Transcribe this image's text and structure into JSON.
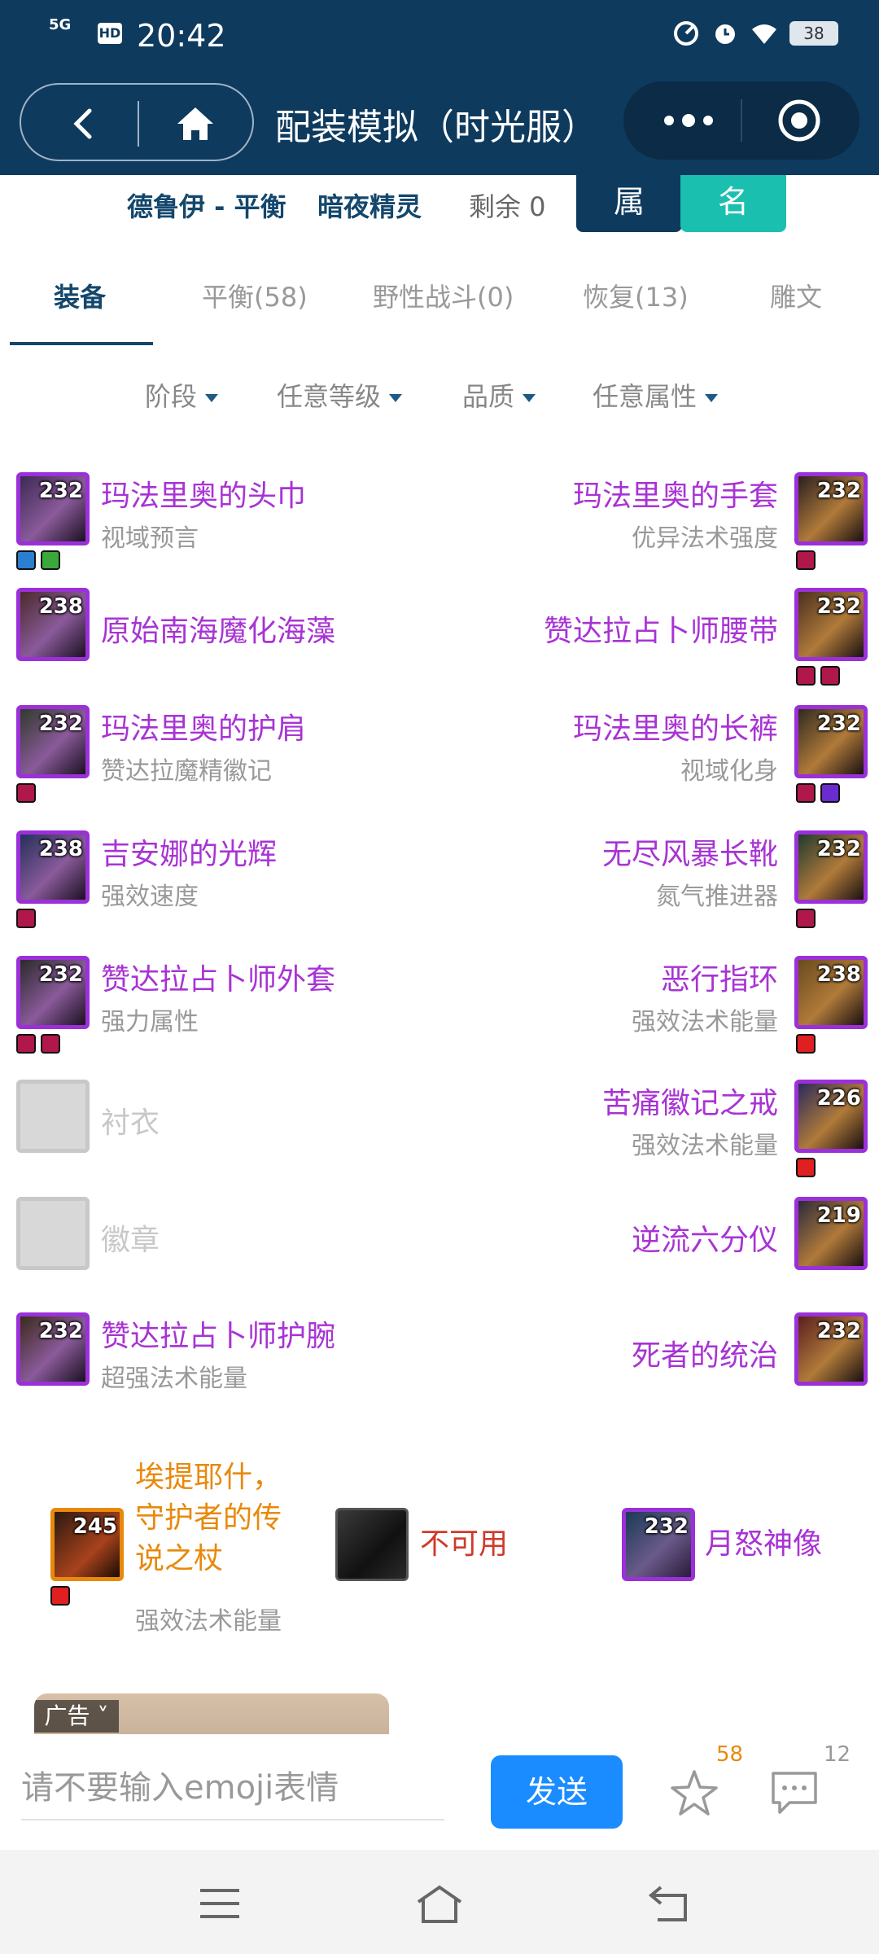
{
  "status_bar": {
    "signal": "5G",
    "hd": "HD",
    "time": "20:42",
    "battery": "38"
  },
  "header": {
    "title": "配装模拟（时光服）"
  },
  "character": {
    "class_spec": "德鲁伊 - 平衡",
    "race": "暗夜精灵",
    "remaining": "剩余 0",
    "attr_button": "属",
    "name_button": "名"
  },
  "tabs": [
    "装备",
    "平衡(58)",
    "野性战斗(0)",
    "恢复(13)",
    "雕文"
  ],
  "filters": [
    "阶段",
    "任意等级",
    "品质",
    "任意属性"
  ],
  "left_items": [
    {
      "level": "232",
      "name": "玛法里奥的头巾",
      "sub": "视域预言",
      "gems": [
        "#2a7fd1",
        "#3aa83a"
      ]
    },
    {
      "level": "238",
      "name": "原始南海魔化海藻",
      "sub": "",
      "gems": []
    },
    {
      "level": "232",
      "name": "玛法里奥的护肩",
      "sub": "赞达拉魔精徽记",
      "gems": [
        "#b0174a"
      ]
    },
    {
      "level": "238",
      "name": "吉安娜的光辉",
      "sub": "强效速度",
      "gems": [
        "#b0174a"
      ]
    },
    {
      "level": "232",
      "name": "赞达拉占卜师外套",
      "sub": "强力属性",
      "gems": [
        "#b0174a",
        "#b0174a"
      ]
    },
    {
      "level": "",
      "name": "衬衣",
      "sub": "",
      "gems": [],
      "empty": true
    },
    {
      "level": "",
      "name": "徽章",
      "sub": "",
      "gems": [],
      "empty": true
    },
    {
      "level": "232",
      "name": "赞达拉占卜师护腕",
      "sub": "超强法术能量",
      "gems": []
    }
  ],
  "right_items": [
    {
      "level": "232",
      "name": "玛法里奥的手套",
      "sub": "优异法术强度",
      "gems": [
        "#b0174a"
      ]
    },
    {
      "level": "232",
      "name": "赞达拉占卜师腰带",
      "sub": "",
      "gems": [
        "#b0174a",
        "#b0174a"
      ]
    },
    {
      "level": "232",
      "name": "玛法里奥的长裤",
      "sub": "视域化身",
      "gems": [
        "#b0174a",
        "#6a2bd1"
      ]
    },
    {
      "level": "232",
      "name": "无尽风暴长靴",
      "sub": "氮气推进器",
      "gems": [
        "#b0174a"
      ]
    },
    {
      "level": "238",
      "name": "恶行指环",
      "sub": "强效法术能量",
      "gems": [
        "#e02020"
      ]
    },
    {
      "level": "226",
      "name": "苦痛徽记之戒",
      "sub": "强效法术能量",
      "gems": [
        "#e02020"
      ]
    },
    {
      "level": "219",
      "name": "逆流六分仪",
      "sub": "",
      "gems": []
    },
    {
      "level": "232",
      "name": "死者的统治",
      "sub": "",
      "gems": []
    }
  ],
  "weapons": {
    "main": {
      "level": "245",
      "name_lines": [
        "埃提耶什，",
        "守护者的传",
        "说之杖"
      ],
      "sub": "强效法术能量",
      "color": "#e8890c"
    },
    "off": {
      "name": "不可用",
      "color": "#d03a2a"
    },
    "ranged": {
      "level": "232",
      "name": "月怒神像",
      "color": "#a833d4"
    }
  },
  "ad": {
    "label": "广告"
  },
  "comment_bar": {
    "placeholder": "请不要输入emoji表情",
    "send": "发送",
    "favorites": "58",
    "comments": "12"
  }
}
